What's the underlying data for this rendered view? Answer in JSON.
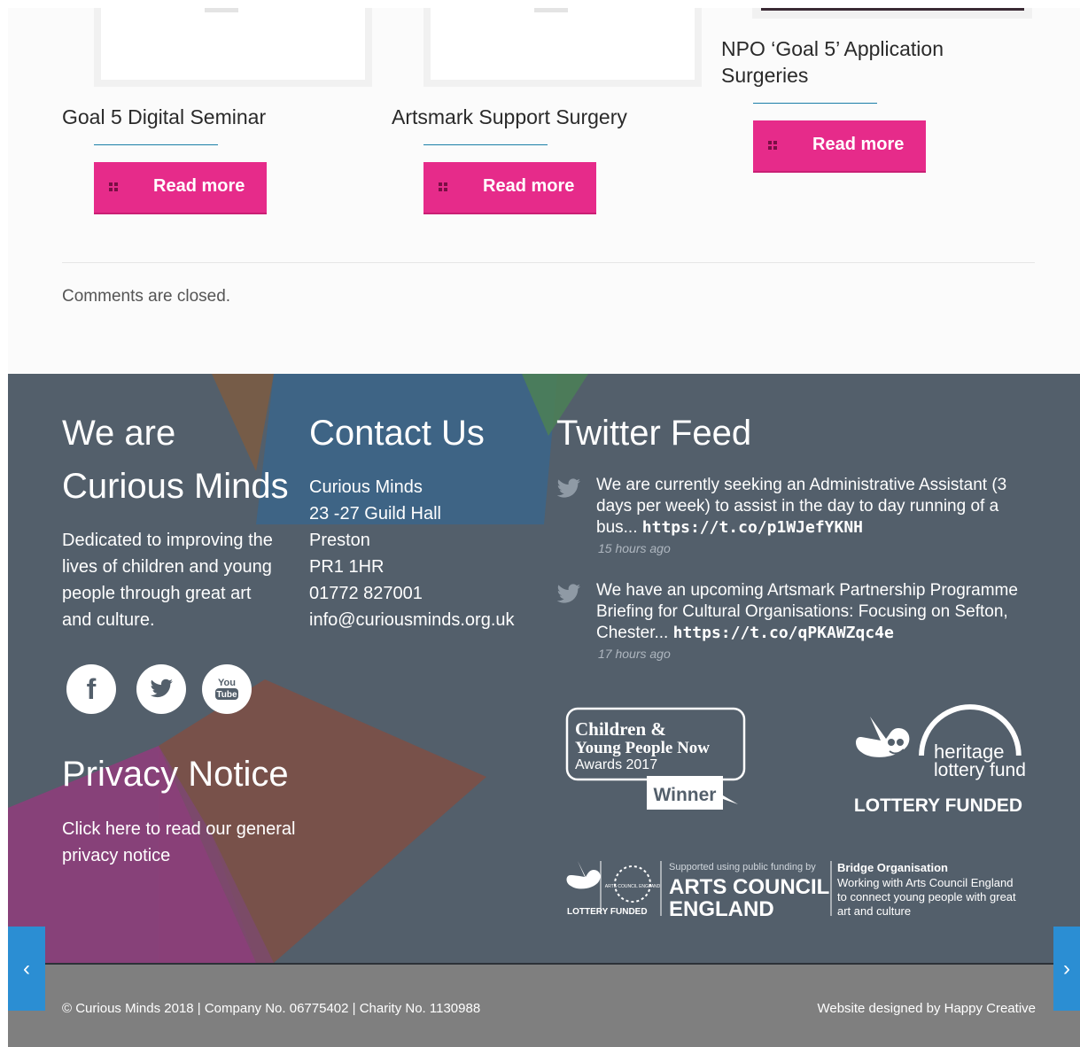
{
  "posts": [
    {
      "title": "Goal 5 Digital Seminar",
      "button": "Read more"
    },
    {
      "title": "Artsmark Support Surgery",
      "button": "Read more"
    },
    {
      "title": "NPO ‘Goal 5’ Application Surgeries",
      "title_line1": "NPO ‘Goal 5’ Application",
      "title_line2": "Surgeries",
      "button": "Read more"
    }
  ],
  "comments_status": "Comments are closed.",
  "footer": {
    "about": {
      "heading_line1": "We are",
      "heading_line2": "Curious Minds",
      "lines": [
        "Dedicated to improving the",
        "lives of children and young",
        "people through great art",
        "and culture."
      ]
    },
    "social": [
      {
        "name": "facebook",
        "glyph": "f"
      },
      {
        "name": "twitter"
      },
      {
        "name": "youtube",
        "top": "You",
        "bottom": "Tube"
      }
    ],
    "privacy": {
      "heading": "Privacy Notice",
      "lines": [
        "Click here to read our general",
        "privacy notice"
      ]
    },
    "contact": {
      "heading": "Contact Us",
      "lines": [
        "Curious Minds",
        "23 -27 Guild Hall",
        "Preston",
        "PR1 1HR",
        "01772 827001",
        "info@curiousminds.org.uk"
      ]
    },
    "twitter": {
      "heading": "Twitter Feed",
      "tweets": [
        {
          "line1": "We are currently seeking an Administrative Assistant (3",
          "line2": "days per week) to assist in the day to day running of a",
          "line3": "bus...",
          "link": "https://t.co/p1WJefYKNH",
          "time": "15 hours ago"
        },
        {
          "line1": "We have an upcoming Artsmark Partnership Programme",
          "line2": "Briefing for Cultural Organisations: Focusing on Sefton,",
          "line3": "Chester...",
          "link": "https://t.co/qPKAWZqc4e",
          "time": "17 hours ago"
        }
      ]
    },
    "logos": {
      "cypn": {
        "line1": "Children &",
        "line2": "Young People Now",
        "line3": "Awards 2017",
        "badge": "Winner"
      },
      "hlf": {
        "line1": "heritage",
        "line2": "lottery fund",
        "caption": "LOTTERY FUNDED"
      },
      "ace": {
        "lottery_caption": "LOTTERY FUNDED",
        "seal_text": "ARTS COUNCIL ENGLAND",
        "supported": "Supported using public funding by",
        "name_line1": "ARTS COUNCIL",
        "name_line2": "ENGLAND",
        "bridge_title": "Bridge Organisation",
        "bridge_lines": [
          "Working with Arts Council England",
          "to connect young people with great",
          "art and culture"
        ]
      }
    }
  },
  "bottom_bar": {
    "copyright": "© Curious Minds 2018 | Company No. 06775402 | Charity No. 1130988",
    "credit": "Website designed by Happy Creative"
  },
  "nav": {
    "prev": "‹",
    "next": "›"
  },
  "colors": {
    "accent": "#e62b8a",
    "footer_bg": "#535f6b",
    "bottom_bar": "#7f7f7f",
    "nav_arrow": "#2b8ed3",
    "separator": "#1b7fa8"
  }
}
